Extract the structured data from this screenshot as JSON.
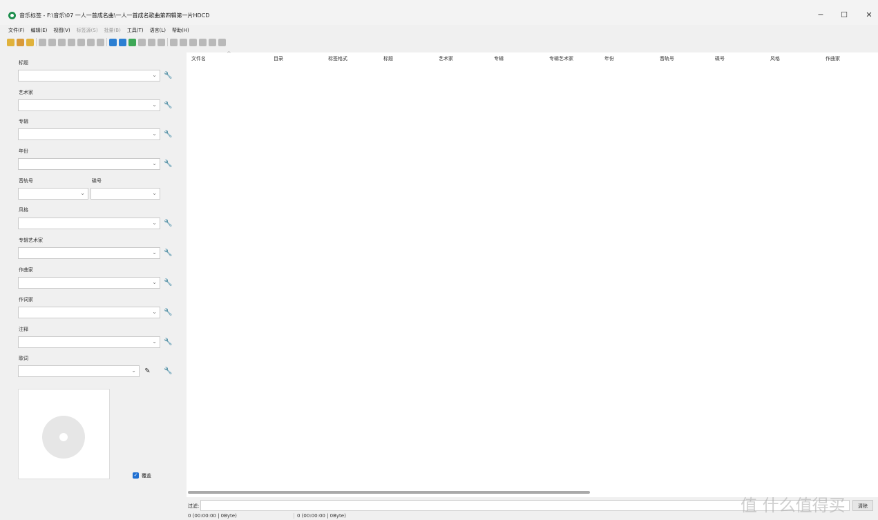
{
  "window": {
    "title": "音乐标签 - F:\\音乐\\07 一人一首成名曲\\一人一首成名歌曲第四辑第一片HDCD",
    "minimize": "−",
    "maximize": "☐",
    "close": "✕"
  },
  "menu": [
    "文件(F)",
    "编辑(E)",
    "视图(V)",
    "标签源(S)",
    "批量(B)",
    "工具(T)",
    "语言(L)",
    "帮助(H)"
  ],
  "fields": {
    "title": "标题",
    "artist": "艺术家",
    "album": "专辑",
    "year": "年份",
    "track": "音轨号",
    "disc": "碟号",
    "genre": "风格",
    "album_artist": "专辑艺术家",
    "composer": "作曲家",
    "lyricist": "作词家",
    "comment": "注释",
    "lyrics": "歌词"
  },
  "cover_overwrite_label": "覆盖",
  "columns": [
    "文件名",
    "目录",
    "标签格式",
    "标题",
    "艺术家",
    "专辑",
    "专辑艺术家",
    "年份",
    "音轨号",
    "碟号",
    "风格",
    "作曲家"
  ],
  "filter": {
    "label": "过滤:",
    "button": "清除"
  },
  "status": {
    "selected": "0 (00:00:00 | 0Byte)",
    "total": "0 (00:00:00 | 0Byte)"
  },
  "watermark": "值 什么值得买",
  "icons": {
    "wrench": "🔧",
    "arrow": "⌄",
    "edit": "✎"
  }
}
